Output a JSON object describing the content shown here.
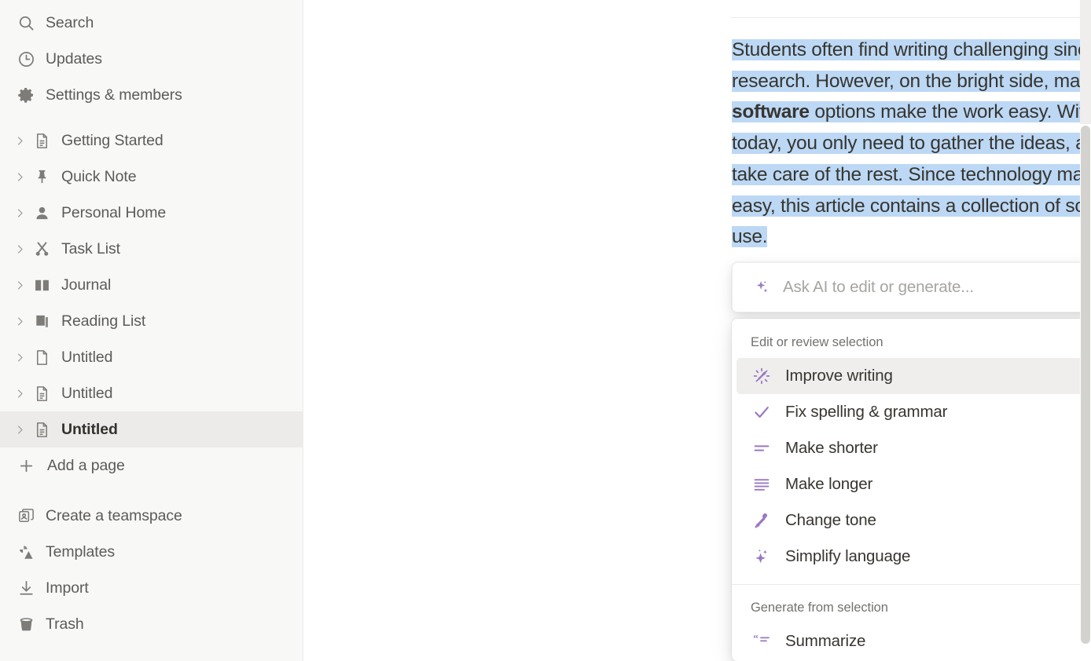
{
  "sidebar": {
    "top_items": [
      {
        "label": "Search",
        "icon": "search-icon"
      },
      {
        "label": "Updates",
        "icon": "clock-icon"
      },
      {
        "label": "Settings & members",
        "icon": "gear-icon"
      }
    ],
    "pages": [
      {
        "label": "Getting Started",
        "icon": "document-icon",
        "active": false
      },
      {
        "label": "Quick Note",
        "icon": "pin-icon",
        "active": false
      },
      {
        "label": "Personal Home",
        "icon": "person-icon",
        "active": false
      },
      {
        "label": "Task List",
        "icon": "scissors-icon",
        "active": false
      },
      {
        "label": "Journal",
        "icon": "book-icon",
        "active": false
      },
      {
        "label": "Reading List",
        "icon": "books-icon",
        "active": false
      },
      {
        "label": "Untitled",
        "icon": "blank-document-icon",
        "active": false
      },
      {
        "label": "Untitled",
        "icon": "document-icon",
        "active": false
      },
      {
        "label": "Untitled",
        "icon": "document-icon",
        "active": true
      }
    ],
    "add_page": {
      "label": "Add a page",
      "icon": "plus-icon"
    },
    "bottom_items": [
      {
        "label": "Create a teamspace",
        "icon": "teamspace-icon"
      },
      {
        "label": "Templates",
        "icon": "templates-icon"
      },
      {
        "label": "Import",
        "icon": "import-icon"
      },
      {
        "label": "Trash",
        "icon": "trash-icon"
      }
    ]
  },
  "document": {
    "paragraph": {
      "part1": "Students often find writing challenging since it includes a lot of research. However, on the bright side, many ",
      "bold": "academic writing software",
      "part2": " options make the work easy. With the tools available today, you only need to gather the ideas, and the software will take care of the rest. Since technology makes academic writing easy, this article contains a collection of software students can use."
    },
    "selection_highlight_color": "#bcd8f5"
  },
  "ai_bar": {
    "placeholder": "Ask AI to edit or generate...",
    "value": "",
    "spark_icon": "sparkle-icon",
    "send_icon": "arrow-up-circle-icon",
    "accent_color": "#9b7cc4"
  },
  "ai_menu": {
    "section_edit_title": "Edit or review selection",
    "edit_items": [
      {
        "label": "Improve writing",
        "icon": "magic-wand-icon",
        "selected": true,
        "accessory": "enter-key-icon"
      },
      {
        "label": "Fix spelling & grammar",
        "icon": "check-icon",
        "selected": false,
        "accessory": ""
      },
      {
        "label": "Make shorter",
        "icon": "shorten-lines-icon",
        "selected": false,
        "accessory": ""
      },
      {
        "label": "Make longer",
        "icon": "lengthen-lines-icon",
        "selected": false,
        "accessory": ""
      },
      {
        "label": "Change tone",
        "icon": "microphone-icon",
        "selected": false,
        "accessory": "chevron-right-icon"
      },
      {
        "label": "Simplify language",
        "icon": "sparkle-icon",
        "selected": false,
        "accessory": ""
      }
    ],
    "section_generate_title": "Generate from selection",
    "generate_items": [
      {
        "label": "Summarize",
        "icon": "quote-icon",
        "selected": false,
        "accessory": ""
      }
    ]
  }
}
